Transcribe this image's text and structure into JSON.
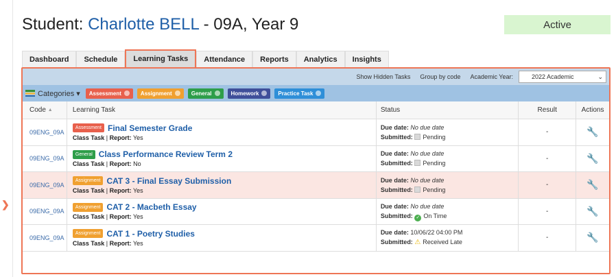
{
  "header": {
    "prefix": "Student: ",
    "student_name": "Charlotte BELL",
    "suffix": " - 09A, Year 9",
    "status": "Active"
  },
  "tabs": [
    "Dashboard",
    "Schedule",
    "Learning Tasks",
    "Attendance",
    "Reports",
    "Analytics",
    "Insights"
  ],
  "active_tab": "Learning Tasks",
  "toolbar": {
    "show_hidden": "Show Hidden Tasks",
    "group_by": "Group by code",
    "year_label": "Academic Year:",
    "year_value": "2022 Academic"
  },
  "categories": {
    "label": "Categories",
    "items": [
      {
        "label": "Assessment",
        "color": "#e8604c"
      },
      {
        "label": "Assignment",
        "color": "#f0a030"
      },
      {
        "label": "General",
        "color": "#2e9e4a"
      },
      {
        "label": "Homework",
        "color": "#3f4f9a"
      },
      {
        "label": "Practice Task",
        "color": "#2f8fd8"
      }
    ]
  },
  "columns": {
    "code": "Code",
    "task": "Learning Task",
    "status": "Status",
    "result": "Result",
    "actions": "Actions"
  },
  "rows": [
    {
      "code": "09ENG_09A",
      "tag": "Assessment",
      "tag_color": "#e8604c",
      "title": "Final Semester Grade",
      "type": "Class Task",
      "report_label": "Report:",
      "report": "Yes",
      "due_label": "Due date:",
      "due": "No due date",
      "submitted_label": "Submitted:",
      "submitted": "Pending",
      "result": "-"
    },
    {
      "code": "09ENG_09A",
      "tag": "General",
      "tag_color": "#2e9e4a",
      "title": "Class Performance Review Term 2",
      "type": "Class Task",
      "report_label": "Report:",
      "report": "No",
      "due_label": "Due date:",
      "due": "No due date",
      "submitted_label": "Submitted:",
      "submitted": "Pending",
      "result": "-"
    },
    {
      "code": "09ENG_09A",
      "tag": "Assignment",
      "tag_color": "#f0a030",
      "title": "CAT 3 - Final Essay Submission",
      "type": "Class Task",
      "report_label": "Report:",
      "report": "Yes",
      "due_label": "Due date:",
      "due": "No due date",
      "submitted_label": "Submitted:",
      "submitted": "Pending",
      "result": "-"
    },
    {
      "code": "09ENG_09A",
      "tag": "Assignment",
      "tag_color": "#f0a030",
      "title": "CAT 2 - Macbeth Essay",
      "type": "Class Task",
      "report_label": "Report:",
      "report": "Yes",
      "due_label": "Due date:",
      "due": "No due date",
      "submitted_label": "Submitted:",
      "submitted": "On Time",
      "result": "-"
    },
    {
      "code": "09ENG_09A",
      "tag": "Assignment",
      "tag_color": "#f0a030",
      "title": "CAT 1 - Poetry Studies",
      "type": "Class Task",
      "report_label": "Report:",
      "report": "Yes",
      "due_label": "Due date:",
      "due": "10/06/22 04:00 PM",
      "submitted_label": "Submitted:",
      "submitted": "Received Late",
      "result": "-"
    }
  ]
}
